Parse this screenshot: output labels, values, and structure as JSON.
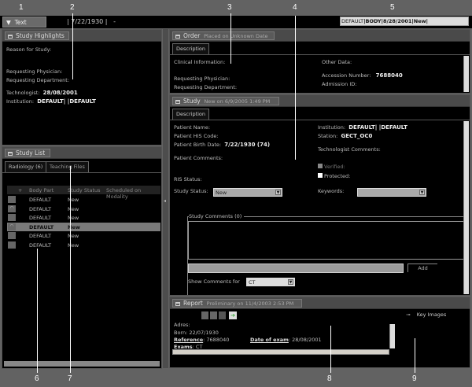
{
  "callouts": [
    "1",
    "2",
    "3",
    "4",
    "5",
    "6",
    "7",
    "8",
    "9"
  ],
  "toolbar": {
    "text_button": "Text",
    "patient_info": "| 7/22/1930 |   -",
    "study_summary_a": "DEFAULT",
    "study_summary_b": "|BODY|8/28/2001|New|"
  },
  "highlights": {
    "title": "Study Highlights",
    "reason": "Reason for Study:",
    "physician": "Requesting Physician:",
    "department": "Requesting Department:",
    "technologist_label": "Technologist:",
    "technologist_value": "28/08/2001",
    "institution_label": "Institution:",
    "institution_value": "DEFAULT| |DEFAULT"
  },
  "study_list": {
    "title": "Study List",
    "tabs": [
      "Radiology (6)",
      "Teaching Files"
    ],
    "columns": [
      "+",
      "Body Part",
      "Study Status",
      "Scheduled on Modality"
    ],
    "rows": [
      {
        "body": "DEFAULT",
        "status": "New",
        "icon": "blank"
      },
      {
        "body": "DEFAULT",
        "status": "New",
        "icon": "eye"
      },
      {
        "body": "DEFAULT",
        "status": "New",
        "icon": "blank"
      },
      {
        "body": "DEFAULT",
        "status": "New",
        "icon": "eye",
        "selected": true
      },
      {
        "body": "DEFAULT",
        "status": "New",
        "icon": "blank"
      },
      {
        "body": "DEFAULT",
        "status": "New",
        "icon": "blank"
      }
    ]
  },
  "order": {
    "title": "Order",
    "subtitle": "Placed on Unknown Date",
    "tab": "Description",
    "clinical": "Clinical Information:",
    "physician": "Requesting Physician:",
    "department": "Requesting Department:",
    "other": "Other Data:",
    "accession_label": "Accession Number:",
    "accession_value": "7688040",
    "admission": "Admission ID:"
  },
  "study": {
    "title": "Study",
    "subtitle": "New on 6/9/2005 1:49 PM",
    "tab": "Description",
    "patient_name": "Patient Name:",
    "his_code": "Patient HIS Code:",
    "birth_label": "Patient Birth Date:",
    "birth_value": "7/22/1930 (74)",
    "comments": "Patient Comments:",
    "institution_label": "Institution:",
    "institution_value": "DEFAULT| |DEFAULT",
    "station_label": "Station:",
    "station_value": "GECT_OC0",
    "tech_comments": "Technologist Comments:",
    "verified": "Verified:",
    "protected": "Protected:",
    "ris_status": "RIS Status:",
    "status_label": "Study Status:",
    "status_value": "New",
    "keywords_label": "Keywords:",
    "keywords_value": "",
    "study_comments": "Study Comments (0)",
    "add": "Add",
    "show_for": "Show Comments for",
    "show_for_value": "CT"
  },
  "report": {
    "title": "Report",
    "subtitle": "Preliminary on  11/4/2003 2:53 PM",
    "key_images": "Key Images",
    "adres": "Adres:",
    "born": "Born: 22/07/1930",
    "reference_label": "Reference",
    "reference_value": ": 7688040",
    "date_label": "Date of exam",
    "date_value": ": 28/08/2001",
    "exams_label": "Exams",
    "exams_value": ": CT"
  }
}
